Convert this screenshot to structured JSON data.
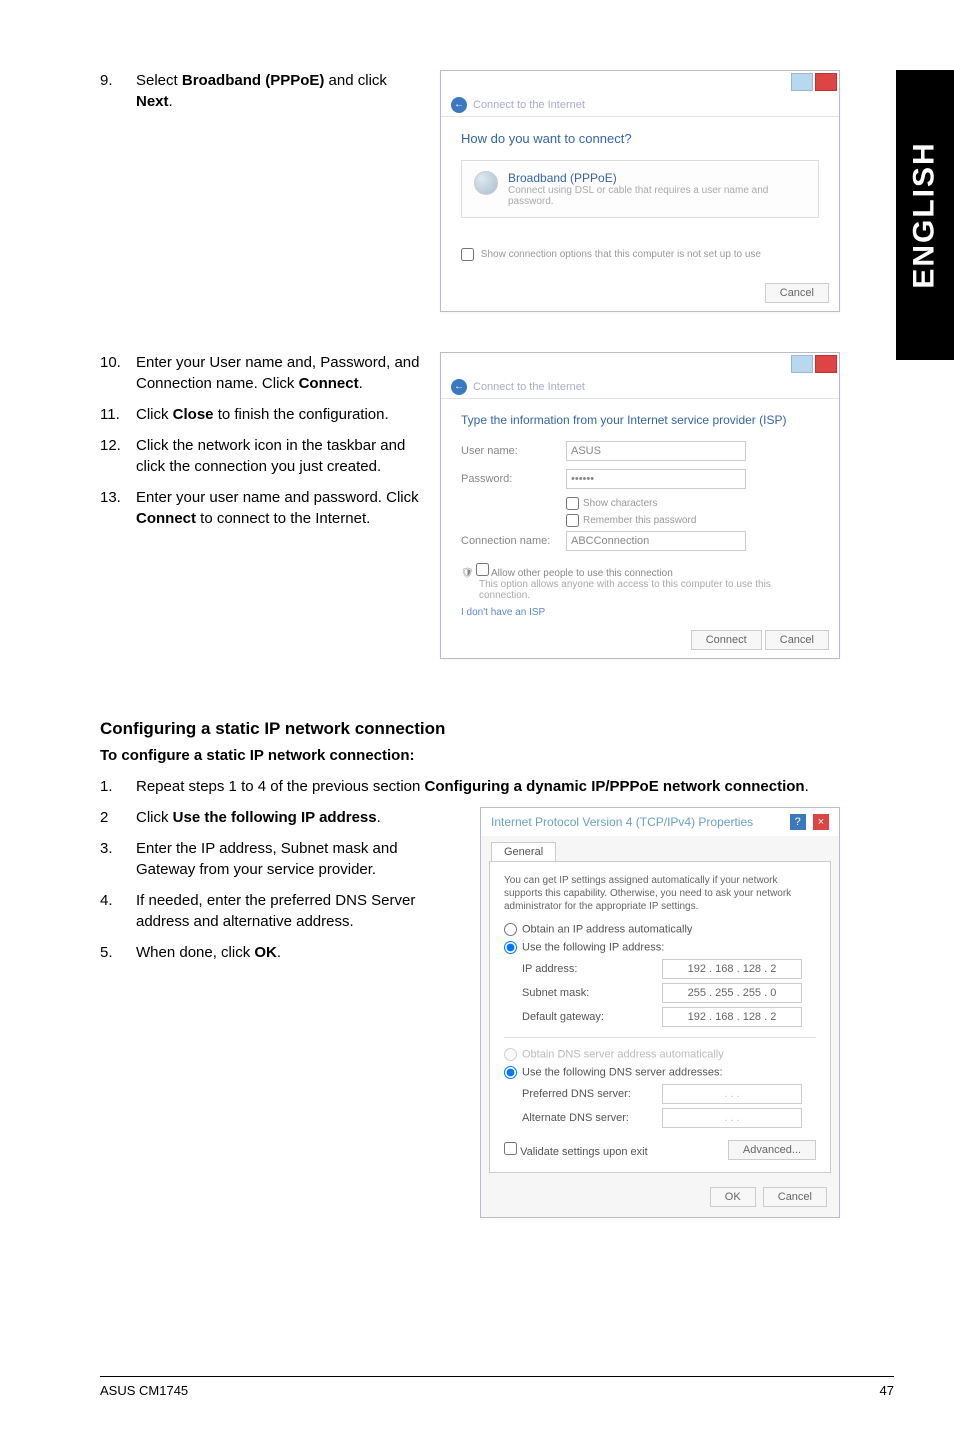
{
  "sideTab": "ENGLISH",
  "step9": {
    "num": "9.",
    "pre": "Select ",
    "bold": "Broadband (PPPoE)",
    "post": " and click ",
    "bold2": "Next",
    "post2": "."
  },
  "dlg1": {
    "back": "Connect to the Internet",
    "question": "How do you want to connect?",
    "optTitle": "Broadband (PPPoE)",
    "optSub": "Connect using DSL or cable that requires a user name and password.",
    "chk": "Show connection options that this computer is not set up to use",
    "cancel": "Cancel"
  },
  "step10": {
    "num": "10.",
    "text_a": "Enter your User name and, Password, and Connection name. Click ",
    "bold": "Connect",
    "text_b": "."
  },
  "step11": {
    "num": "11.",
    "text_a": "Click ",
    "bold": "Close",
    "text_b": " to finish the configuration."
  },
  "step12": {
    "num": "12.",
    "text": "Click the network icon in the taskbar and click the connection you just created."
  },
  "step13": {
    "num": "13.",
    "text_a": "Enter your user name and password. Click ",
    "bold": "Connect",
    "text_b": " to connect to the Internet."
  },
  "dlg2": {
    "back": "Connect to the Internet",
    "heading": "Type the information from your Internet service provider (ISP)",
    "user_lbl": "User name:",
    "user_val": "ASUS",
    "pass_lbl": "Password:",
    "pass_val": "••••••",
    "chk_show": "Show characters",
    "chk_rem": "Remember this password",
    "conn_lbl": "Connection name:",
    "conn_val": "ABCConnection",
    "allow_chk": "Allow other people to use this connection",
    "allow_desc": "This option allows anyone with access to this computer to use this connection.",
    "link": "I don't have an ISP",
    "connect": "Connect",
    "cancel": "Cancel"
  },
  "section": {
    "h3": "Configuring a static IP network connection",
    "h4": "To configure a static IP network connection:"
  },
  "bstep1": {
    "num": "1.",
    "text_a": "Repeat steps 1 to 4 of the previous section ",
    "bold": "Configuring a dynamic IP/PPPoE network connection",
    "text_b": "."
  },
  "bstep2": {
    "num": "2",
    "text_a": "Click ",
    "bold": "Use the following IP address",
    "text_b": "."
  },
  "bstep3": {
    "num": "3.",
    "text": "Enter the IP address, Subnet mask and Gateway from your service provider."
  },
  "bstep4": {
    "num": "4.",
    "text": "If needed, enter the preferred DNS Server address and alternative address."
  },
  "bstep5": {
    "num": "5.",
    "text_a": "When done, click ",
    "bold": "OK",
    "text_b": "."
  },
  "ipv4": {
    "title": "Internet Protocol Version 4 (TCP/IPv4) Properties",
    "tab": "General",
    "desc": "You can get IP settings assigned automatically if your network supports this capability. Otherwise, you need to ask your network administrator for the appropriate IP settings.",
    "r1": "Obtain an IP address automatically",
    "r2": "Use the following IP address:",
    "ip_lbl": "IP address:",
    "ip_val": "192 . 168 . 128 .   2",
    "sm_lbl": "Subnet mask:",
    "sm_val": "255 . 255 . 255 .   0",
    "gw_lbl": "Default gateway:",
    "gw_val": "192 . 168 . 128 .   2",
    "r3": "Obtain DNS server address automatically",
    "r4": "Use the following DNS server addresses:",
    "pdns_lbl": "Preferred DNS server:",
    "adns_lbl": "Alternate DNS server:",
    "dot_blank": ".       .       .",
    "val_chk": "Validate settings upon exit",
    "adv": "Advanced...",
    "ok": "OK",
    "cancel": "Cancel"
  },
  "footer": {
    "left": "ASUS CM1745",
    "right": "47"
  }
}
